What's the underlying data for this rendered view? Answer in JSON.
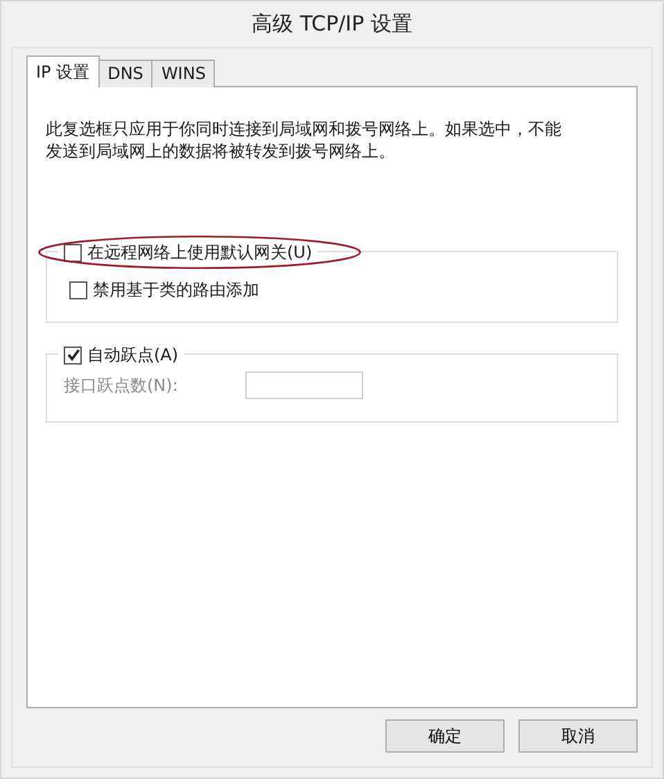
{
  "window": {
    "title": "高级 TCP/IP 设置"
  },
  "tabs": [
    {
      "label": "IP 设置",
      "selected": true
    },
    {
      "label": "DNS",
      "selected": false
    },
    {
      "label": "WINS",
      "selected": false
    }
  ],
  "description": "此复选框只应用于你同时连接到局域网和拨号网络上。如果选中，不能发送到局域网上的数据将被转发到拨号网络上。",
  "gateway_group": {
    "checkbox": {
      "label": "在远程网络上使用默认网关(U)",
      "checked": false,
      "highlighted": true
    },
    "options": [
      {
        "label": "禁用基于类的路由添加",
        "checked": false
      }
    ]
  },
  "metric_group": {
    "checkbox": {
      "label": "自动跃点(A)",
      "checked": true
    },
    "field": {
      "label": "接口跃点数(N):",
      "disabled": true
    }
  },
  "buttons": [
    {
      "label": "确定"
    },
    {
      "label": "取消"
    }
  ]
}
